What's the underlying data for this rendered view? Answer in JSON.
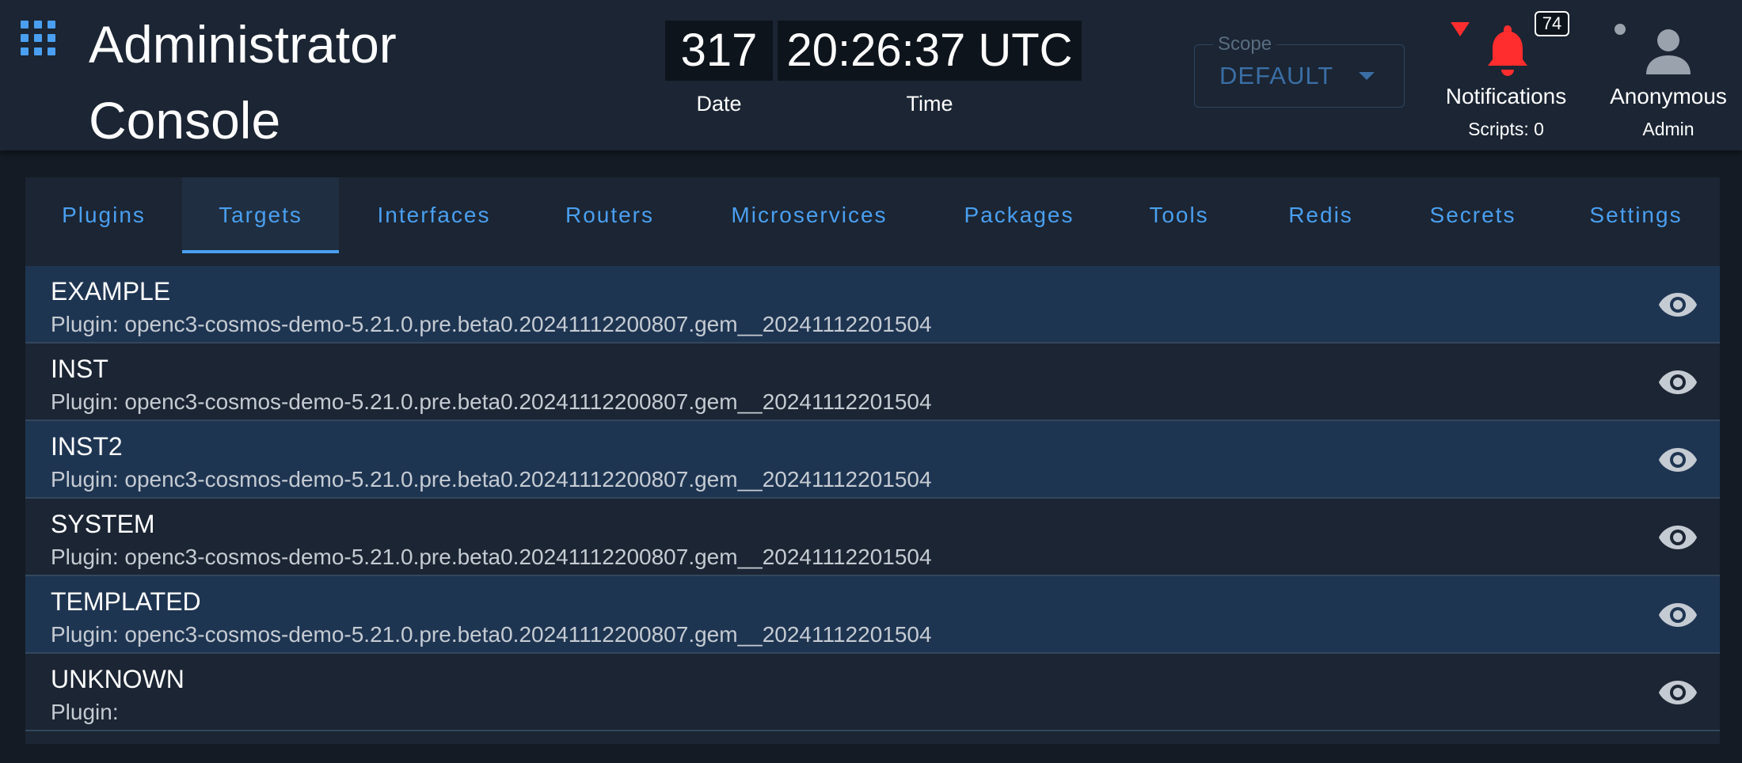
{
  "header": {
    "title_line1": "Administrator",
    "title_line2": "Console",
    "date_value": "317",
    "date_label": "Date",
    "time_value": "20:26:37 UTC",
    "time_label": "Time",
    "scope_label": "Scope",
    "scope_value": "DEFAULT",
    "notifications_badge": "74",
    "notifications_label": "Notifications",
    "notifications_sub": "Scripts: 0",
    "user_label": "Anonymous",
    "user_sub": "Admin"
  },
  "tabs": [
    {
      "label": "Plugins"
    },
    {
      "label": "Targets"
    },
    {
      "label": "Interfaces"
    },
    {
      "label": "Routers"
    },
    {
      "label": "Microservices"
    },
    {
      "label": "Packages"
    },
    {
      "label": "Tools"
    },
    {
      "label": "Redis"
    },
    {
      "label": "Secrets"
    },
    {
      "label": "Settings"
    }
  ],
  "active_tab": "Targets",
  "targets": [
    {
      "name": "EXAMPLE",
      "plugin": "Plugin: openc3-cosmos-demo-5.21.0.pre.beta0.20241112200807.gem__20241112201504"
    },
    {
      "name": "INST",
      "plugin": "Plugin: openc3-cosmos-demo-5.21.0.pre.beta0.20241112200807.gem__20241112201504"
    },
    {
      "name": "INST2",
      "plugin": "Plugin: openc3-cosmos-demo-5.21.0.pre.beta0.20241112200807.gem__20241112201504"
    },
    {
      "name": "SYSTEM",
      "plugin": "Plugin: openc3-cosmos-demo-5.21.0.pre.beta0.20241112200807.gem__20241112201504"
    },
    {
      "name": "TEMPLATED",
      "plugin": "Plugin: openc3-cosmos-demo-5.21.0.pre.beta0.20241112200807.gem__20241112201504"
    },
    {
      "name": "UNKNOWN",
      "plugin": "Plugin:"
    }
  ],
  "icons": {
    "apps": "apps-grid-icon",
    "alert": "alert-triangle-icon",
    "bell": "bell-icon",
    "user": "account-icon",
    "view": "eye-icon"
  },
  "colors": {
    "accent": "#4a9ff0",
    "alert": "#ff2d2d",
    "header_bg": "#1b2533",
    "row_highlight": "#1e3552"
  }
}
